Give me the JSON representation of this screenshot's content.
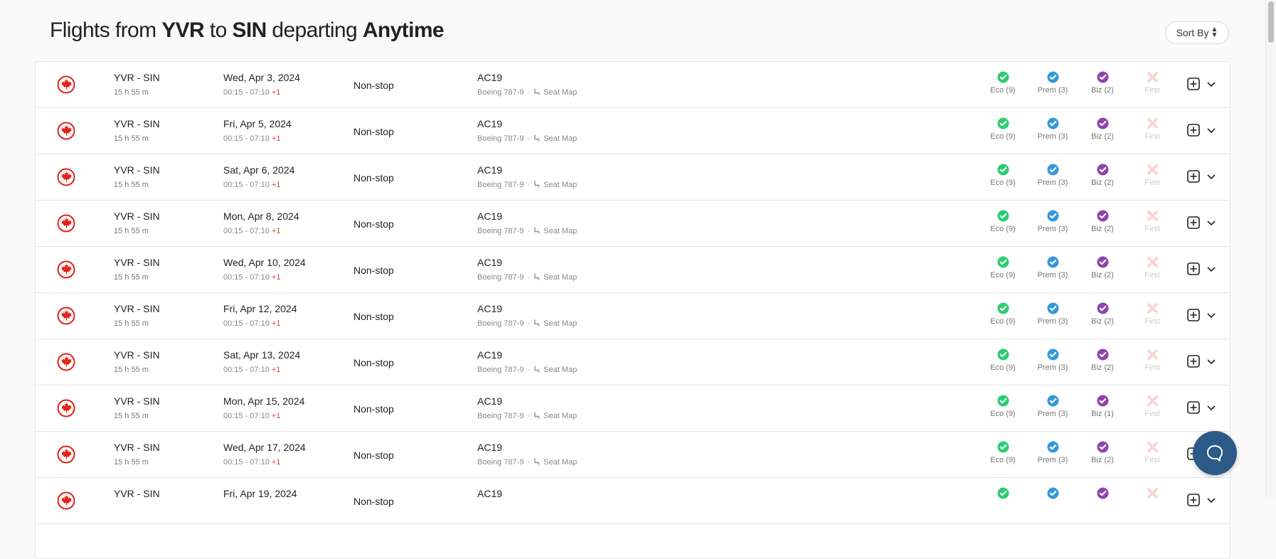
{
  "header": {
    "title_parts": {
      "t1": "Flights from ",
      "origin": "YVR",
      "t2": " to ",
      "destination": "SIN",
      "t3": " departing ",
      "when": "Anytime"
    },
    "sort_label": "Sort By"
  },
  "colors": {
    "eco": "#2ecc71",
    "prem": "#3498db",
    "biz": "#8e44ad",
    "first_unavailable": "#f9d6d2",
    "airline": "#e2231a",
    "chat": "#2c5a88",
    "next_day": "#e04040"
  },
  "icons": {
    "airline_logo": "air-canada-maple-leaf",
    "available": "check-circle",
    "unavailable": "x-mark",
    "add": "plus-square",
    "expand": "chevron-down",
    "seat": "seat",
    "chat": "chat-bubble"
  },
  "flights": [
    {
      "route": "YVR - SIN",
      "duration": "15 h 55 m",
      "date": "Wed, Apr 3, 2024",
      "times": "00:15 - 07:10",
      "day_offset": "+1",
      "stops": "Non-stop",
      "flight_no": "AC19",
      "aircraft": "Boeing 787-9",
      "seat_map": "Seat Map",
      "eco": "Eco (9)",
      "prem": "Prem (3)",
      "biz": "Biz (2)",
      "first": "First"
    },
    {
      "route": "YVR - SIN",
      "duration": "15 h 55 m",
      "date": "Fri, Apr 5, 2024",
      "times": "00:15 - 07:10",
      "day_offset": "+1",
      "stops": "Non-stop",
      "flight_no": "AC19",
      "aircraft": "Boeing 787-9",
      "seat_map": "Seat Map",
      "eco": "Eco (9)",
      "prem": "Prem (3)",
      "biz": "Biz (2)",
      "first": "First"
    },
    {
      "route": "YVR - SIN",
      "duration": "15 h 55 m",
      "date": "Sat, Apr 6, 2024",
      "times": "00:15 - 07:10",
      "day_offset": "+1",
      "stops": "Non-stop",
      "flight_no": "AC19",
      "aircraft": "Boeing 787-9",
      "seat_map": "Seat Map",
      "eco": "Eco (9)",
      "prem": "Prem (3)",
      "biz": "Biz (2)",
      "first": "First"
    },
    {
      "route": "YVR - SIN",
      "duration": "15 h 55 m",
      "date": "Mon, Apr 8, 2024",
      "times": "00:15 - 07:10",
      "day_offset": "+1",
      "stops": "Non-stop",
      "flight_no": "AC19",
      "aircraft": "Boeing 787-9",
      "seat_map": "Seat Map",
      "eco": "Eco (9)",
      "prem": "Prem (3)",
      "biz": "Biz (2)",
      "first": "First"
    },
    {
      "route": "YVR - SIN",
      "duration": "15 h 55 m",
      "date": "Wed, Apr 10, 2024",
      "times": "00:15 - 07:10",
      "day_offset": "+1",
      "stops": "Non-stop",
      "flight_no": "AC19",
      "aircraft": "Boeing 787-9",
      "seat_map": "Seat Map",
      "eco": "Eco (9)",
      "prem": "Prem (3)",
      "biz": "Biz (2)",
      "first": "First"
    },
    {
      "route": "YVR - SIN",
      "duration": "15 h 55 m",
      "date": "Fri, Apr 12, 2024",
      "times": "00:15 - 07:10",
      "day_offset": "+1",
      "stops": "Non-stop",
      "flight_no": "AC19",
      "aircraft": "Boeing 787-9",
      "seat_map": "Seat Map",
      "eco": "Eco (9)",
      "prem": "Prem (3)",
      "biz": "Biz (2)",
      "first": "First"
    },
    {
      "route": "YVR - SIN",
      "duration": "15 h 55 m",
      "date": "Sat, Apr 13, 2024",
      "times": "00:15 - 07:10",
      "day_offset": "+1",
      "stops": "Non-stop",
      "flight_no": "AC19",
      "aircraft": "Boeing 787-9",
      "seat_map": "Seat Map",
      "eco": "Eco (9)",
      "prem": "Prem (3)",
      "biz": "Biz (2)",
      "first": "First"
    },
    {
      "route": "YVR - SIN",
      "duration": "15 h 55 m",
      "date": "Mon, Apr 15, 2024",
      "times": "00:15 - 07:10",
      "day_offset": "+1",
      "stops": "Non-stop",
      "flight_no": "AC19",
      "aircraft": "Boeing 787-9",
      "seat_map": "Seat Map",
      "eco": "Eco (9)",
      "prem": "Prem (3)",
      "biz": "Biz (1)",
      "first": "First"
    },
    {
      "route": "YVR - SIN",
      "duration": "15 h 55 m",
      "date": "Wed, Apr 17, 2024",
      "times": "00:15 - 07:10",
      "day_offset": "+1",
      "stops": "Non-stop",
      "flight_no": "AC19",
      "aircraft": "Boeing 787-9",
      "seat_map": "Seat Map",
      "eco": "Eco (9)",
      "prem": "Prem (3)",
      "biz": "Biz (2)",
      "first": "First"
    },
    {
      "route": "YVR - SIN",
      "duration": "",
      "date": "Fri, Apr 19, 2024",
      "times": "",
      "day_offset": "",
      "stops": "Non-stop",
      "flight_no": "AC19",
      "aircraft": "",
      "seat_map": "",
      "eco": "",
      "prem": "",
      "biz": "",
      "first": ""
    }
  ]
}
